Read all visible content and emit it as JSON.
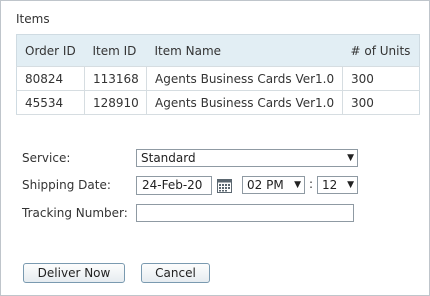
{
  "section_title": "Items",
  "table": {
    "headers": [
      "Order ID",
      "Item ID",
      "Item Name",
      "# of Units"
    ],
    "rows": [
      [
        "80824",
        "113168",
        "Agents Business Cards Ver1.0",
        "300"
      ],
      [
        "45534",
        "128910",
        "Agents Business Cards Ver1.0",
        "300"
      ]
    ]
  },
  "form": {
    "service_label": "Service:",
    "service_value": "Standard",
    "shipping_date_label": "Shipping Date:",
    "shipping_date_value": "24-Feb-20",
    "hour_value": "02 PM",
    "minute_separator": ":",
    "minute_value": "12",
    "tracking_label": "Tracking Number:",
    "tracking_value": ""
  },
  "buttons": {
    "deliver_now": "Deliver Now",
    "cancel": "Cancel"
  },
  "icons": {
    "calendar": "calendar-icon",
    "dropdown": "chevron-down-icon"
  }
}
